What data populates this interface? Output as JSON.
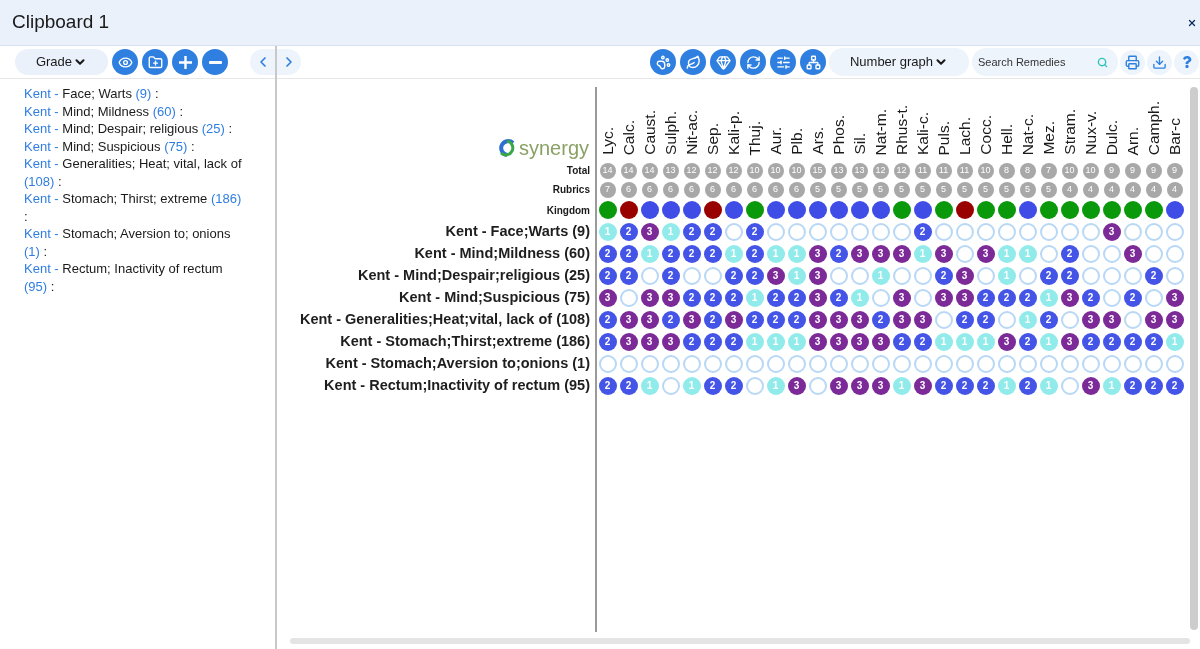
{
  "window": {
    "title": "Clipboard 1"
  },
  "left_toolbar": {
    "grade_dropdown": "Grade"
  },
  "clipboard_list": [
    {
      "source": "Kent -",
      "rubric": "Face; Warts",
      "count": "(9)",
      "suffix": ":"
    },
    {
      "source": "Kent -",
      "rubric": "Mind; Mildness",
      "count": "(60)",
      "suffix": ":"
    },
    {
      "source": "Kent -",
      "rubric": "Mind; Despair; religious",
      "count": "(25)",
      "suffix": ":"
    },
    {
      "source": "Kent -",
      "rubric": "Mind; Suspicious",
      "count": "(75)",
      "suffix": ":"
    },
    {
      "source": "Kent -",
      "rubric": "Generalities; Heat; vital, lack of",
      "count": "(108)",
      "suffix": ":"
    },
    {
      "source": "Kent -",
      "rubric": "Stomach; Thirst; extreme",
      "count": "(186)",
      "suffix": ":"
    },
    {
      "source": "Kent -",
      "rubric": "Stomach; Aversion to; onions",
      "count": "(1)",
      "suffix": ":"
    },
    {
      "source": "Kent -",
      "rubric": "Rectum; Inactivity of rectum",
      "count": "(95)",
      "suffix": ":"
    }
  ],
  "right_toolbar": {
    "graph_dropdown": "Number graph",
    "search": {
      "placeholder": "Search Remedies"
    }
  },
  "chart": {
    "logo": "synergy",
    "row_headers": {
      "total": "Total",
      "rubrics": "Rubrics",
      "kingdom": "Kingdom"
    },
    "remedies": [
      {
        "name": "Lyc.",
        "total": "14",
        "rubrics": "7",
        "color": "#0a990a"
      },
      {
        "name": "Calc.",
        "total": "14",
        "rubrics": "6",
        "color": "#990000"
      },
      {
        "name": "Caust.",
        "total": "14",
        "rubrics": "6",
        "color": "#3f4ce6"
      },
      {
        "name": "Sulph.",
        "total": "13",
        "rubrics": "6",
        "color": "#3f4ce6"
      },
      {
        "name": "Nit-ac.",
        "total": "12",
        "rubrics": "6",
        "color": "#3f4ce6"
      },
      {
        "name": "Sep.",
        "total": "12",
        "rubrics": "6",
        "color": "#990000"
      },
      {
        "name": "Kali-p.",
        "total": "12",
        "rubrics": "6",
        "color": "#3f4ce6"
      },
      {
        "name": "Thuj.",
        "total": "10",
        "rubrics": "6",
        "color": "#0a990a"
      },
      {
        "name": "Aur.",
        "total": "10",
        "rubrics": "6",
        "color": "#3f4ce6"
      },
      {
        "name": "Plb.",
        "total": "10",
        "rubrics": "6",
        "color": "#3f4ce6"
      },
      {
        "name": "Ars.",
        "total": "15",
        "rubrics": "5",
        "color": "#3f4ce6"
      },
      {
        "name": "Phos.",
        "total": "13",
        "rubrics": "5",
        "color": "#3f4ce6"
      },
      {
        "name": "Sil.",
        "total": "13",
        "rubrics": "5",
        "color": "#3f4ce6"
      },
      {
        "name": "Nat-m.",
        "total": "12",
        "rubrics": "5",
        "color": "#3f4ce6"
      },
      {
        "name": "Rhus-t.",
        "total": "12",
        "rubrics": "5",
        "color": "#0a990a"
      },
      {
        "name": "Kali-c.",
        "total": "11",
        "rubrics": "5",
        "color": "#3f4ce6"
      },
      {
        "name": "Puls.",
        "total": "11",
        "rubrics": "5",
        "color": "#0a990a"
      },
      {
        "name": "Lach.",
        "total": "11",
        "rubrics": "5",
        "color": "#990000"
      },
      {
        "name": "Cocc.",
        "total": "10",
        "rubrics": "5",
        "color": "#0a990a"
      },
      {
        "name": "Hell.",
        "total": "8",
        "rubrics": "5",
        "color": "#0a990a"
      },
      {
        "name": "Nat-c.",
        "total": "8",
        "rubrics": "5",
        "color": "#3f4ce6"
      },
      {
        "name": "Mez.",
        "total": "7",
        "rubrics": "5",
        "color": "#0a990a"
      },
      {
        "name": "Stram.",
        "total": "10",
        "rubrics": "4",
        "color": "#0a990a"
      },
      {
        "name": "Nux-v.",
        "total": "10",
        "rubrics": "4",
        "color": "#0a990a"
      },
      {
        "name": "Dulc.",
        "total": "9",
        "rubrics": "4",
        "color": "#0a990a"
      },
      {
        "name": "Arn.",
        "total": "9",
        "rubrics": "4",
        "color": "#0a990a"
      },
      {
        "name": "Camph.",
        "total": "9",
        "rubrics": "4",
        "color": "#0a990a"
      },
      {
        "name": "Bar-c",
        "total": "9",
        "rubrics": "4",
        "color": "#3f4ce6"
      }
    ],
    "rows": [
      {
        "label": "Kent - Face;Warts (9)",
        "cells": [
          {
            "grade": "1",
            "color": "#92ebeb"
          },
          {
            "grade": "2",
            "color": "#4454e6"
          },
          {
            "grade": "3",
            "color": "#7b2a97"
          },
          {
            "grade": "1",
            "color": "#92ebeb"
          },
          {
            "grade": "2",
            "color": "#4454e6"
          },
          {
            "grade": "2",
            "color": "#4454e6"
          },
          null,
          {
            "grade": "2",
            "color": "#4454e6"
          },
          null,
          null,
          null,
          null,
          null,
          null,
          null,
          {
            "grade": "2",
            "color": "#4454e6"
          },
          null,
          null,
          null,
          null,
          null,
          null,
          null,
          null,
          {
            "grade": "3",
            "color": "#7b2a97"
          },
          null,
          null,
          null
        ]
      },
      {
        "label": "Kent - Mind;Mildness (60)",
        "cells": [
          {
            "grade": "2",
            "color": "#4454e6"
          },
          {
            "grade": "2",
            "color": "#4454e6"
          },
          {
            "grade": "1",
            "color": "#92ebeb"
          },
          {
            "grade": "2",
            "color": "#4454e6"
          },
          {
            "grade": "2",
            "color": "#4454e6"
          },
          {
            "grade": "2",
            "color": "#4454e6"
          },
          {
            "grade": "1",
            "color": "#92ebeb"
          },
          {
            "grade": "2",
            "color": "#4454e6"
          },
          {
            "grade": "1",
            "color": "#92ebeb"
          },
          {
            "grade": "1",
            "color": "#92ebeb"
          },
          {
            "grade": "3",
            "color": "#7b2a97"
          },
          {
            "grade": "2",
            "color": "#4454e6"
          },
          {
            "grade": "3",
            "color": "#7b2a97"
          },
          {
            "grade": "3",
            "color": "#7b2a97"
          },
          {
            "grade": "3",
            "color": "#7b2a97"
          },
          {
            "grade": "1",
            "color": "#92ebeb"
          },
          {
            "grade": "3",
            "color": "#7b2a97"
          },
          null,
          {
            "grade": "3",
            "color": "#7b2a97"
          },
          {
            "grade": "1",
            "color": "#92ebeb"
          },
          {
            "grade": "1",
            "color": "#92ebeb"
          },
          null,
          {
            "grade": "2",
            "color": "#4454e6"
          },
          null,
          null,
          {
            "grade": "3",
            "color": "#7b2a97"
          },
          null,
          null
        ]
      },
      {
        "label": "Kent - Mind;Despair;religious (25)",
        "cells": [
          {
            "grade": "2",
            "color": "#4454e6"
          },
          {
            "grade": "2",
            "color": "#4454e6"
          },
          null,
          {
            "grade": "2",
            "color": "#4454e6"
          },
          null,
          null,
          {
            "grade": "2",
            "color": "#4454e6"
          },
          {
            "grade": "2",
            "color": "#4454e6"
          },
          {
            "grade": "3",
            "color": "#7b2a97"
          },
          {
            "grade": "1",
            "color": "#92ebeb"
          },
          {
            "grade": "3",
            "color": "#7b2a97"
          },
          null,
          null,
          {
            "grade": "1",
            "color": "#92ebeb"
          },
          null,
          null,
          {
            "grade": "2",
            "color": "#4454e6"
          },
          {
            "grade": "3",
            "color": "#7b2a97"
          },
          null,
          {
            "grade": "1",
            "color": "#92ebeb"
          },
          null,
          {
            "grade": "2",
            "color": "#4454e6"
          },
          {
            "grade": "2",
            "color": "#4454e6"
          },
          null,
          null,
          null,
          {
            "grade": "2",
            "color": "#4454e6"
          },
          null
        ]
      },
      {
        "label": "Kent - Mind;Suspicious (75)",
        "cells": [
          {
            "grade": "3",
            "color": "#7b2a97"
          },
          null,
          {
            "grade": "3",
            "color": "#7b2a97"
          },
          {
            "grade": "3",
            "color": "#7b2a97"
          },
          {
            "grade": "2",
            "color": "#4454e6"
          },
          {
            "grade": "2",
            "color": "#4454e6"
          },
          {
            "grade": "2",
            "color": "#4454e6"
          },
          {
            "grade": "1",
            "color": "#92ebeb"
          },
          {
            "grade": "2",
            "color": "#4454e6"
          },
          {
            "grade": "2",
            "color": "#4454e6"
          },
          {
            "grade": "3",
            "color": "#7b2a97"
          },
          {
            "grade": "2",
            "color": "#4454e6"
          },
          {
            "grade": "1",
            "color": "#92ebeb"
          },
          null,
          {
            "grade": "3",
            "color": "#7b2a97"
          },
          null,
          {
            "grade": "3",
            "color": "#7b2a97"
          },
          {
            "grade": "3",
            "color": "#7b2a97"
          },
          {
            "grade": "2",
            "color": "#4454e6"
          },
          {
            "grade": "2",
            "color": "#4454e6"
          },
          {
            "grade": "2",
            "color": "#4454e6"
          },
          {
            "grade": "1",
            "color": "#92ebeb"
          },
          {
            "grade": "3",
            "color": "#7b2a97"
          },
          {
            "grade": "2",
            "color": "#4454e6"
          },
          null,
          {
            "grade": "2",
            "color": "#4454e6"
          },
          null,
          {
            "grade": "3",
            "color": "#7b2a97"
          }
        ]
      },
      {
        "label": "Kent - Generalities;Heat;vital, lack of (108)",
        "cells": [
          {
            "grade": "2",
            "color": "#4454e6"
          },
          {
            "grade": "3",
            "color": "#7b2a97"
          },
          {
            "grade": "3",
            "color": "#7b2a97"
          },
          {
            "grade": "2",
            "color": "#4454e6"
          },
          {
            "grade": "3",
            "color": "#7b2a97"
          },
          {
            "grade": "2",
            "color": "#4454e6"
          },
          {
            "grade": "3",
            "color": "#7b2a97"
          },
          {
            "grade": "2",
            "color": "#4454e6"
          },
          {
            "grade": "2",
            "color": "#4454e6"
          },
          {
            "grade": "2",
            "color": "#4454e6"
          },
          {
            "grade": "3",
            "color": "#7b2a97"
          },
          {
            "grade": "3",
            "color": "#7b2a97"
          },
          {
            "grade": "3",
            "color": "#7b2a97"
          },
          {
            "grade": "2",
            "color": "#4454e6"
          },
          {
            "grade": "3",
            "color": "#7b2a97"
          },
          {
            "grade": "3",
            "color": "#7b2a97"
          },
          null,
          {
            "grade": "2",
            "color": "#4454e6"
          },
          {
            "grade": "2",
            "color": "#4454e6"
          },
          null,
          {
            "grade": "1",
            "color": "#92ebeb"
          },
          {
            "grade": "2",
            "color": "#4454e6"
          },
          null,
          {
            "grade": "3",
            "color": "#7b2a97"
          },
          {
            "grade": "3",
            "color": "#7b2a97"
          },
          null,
          {
            "grade": "3",
            "color": "#7b2a97"
          },
          {
            "grade": "3",
            "color": "#7b2a97"
          }
        ]
      },
      {
        "label": "Kent - Stomach;Thirst;extreme (186)",
        "cells": [
          {
            "grade": "2",
            "color": "#4454e6"
          },
          {
            "grade": "3",
            "color": "#7b2a97"
          },
          {
            "grade": "3",
            "color": "#7b2a97"
          },
          {
            "grade": "3",
            "color": "#7b2a97"
          },
          {
            "grade": "2",
            "color": "#4454e6"
          },
          {
            "grade": "2",
            "color": "#4454e6"
          },
          {
            "grade": "2",
            "color": "#4454e6"
          },
          {
            "grade": "1",
            "color": "#92ebeb"
          },
          {
            "grade": "1",
            "color": "#92ebeb"
          },
          {
            "grade": "1",
            "color": "#92ebeb"
          },
          {
            "grade": "3",
            "color": "#7b2a97"
          },
          {
            "grade": "3",
            "color": "#7b2a97"
          },
          {
            "grade": "3",
            "color": "#7b2a97"
          },
          {
            "grade": "3",
            "color": "#7b2a97"
          },
          {
            "grade": "2",
            "color": "#4454e6"
          },
          {
            "grade": "2",
            "color": "#4454e6"
          },
          {
            "grade": "1",
            "color": "#92ebeb"
          },
          {
            "grade": "1",
            "color": "#92ebeb"
          },
          {
            "grade": "1",
            "color": "#92ebeb"
          },
          {
            "grade": "3",
            "color": "#7b2a97"
          },
          {
            "grade": "2",
            "color": "#4454e6"
          },
          {
            "grade": "1",
            "color": "#92ebeb"
          },
          {
            "grade": "3",
            "color": "#7b2a97"
          },
          {
            "grade": "2",
            "color": "#4454e6"
          },
          {
            "grade": "2",
            "color": "#4454e6"
          },
          {
            "grade": "2",
            "color": "#4454e6"
          },
          {
            "grade": "2",
            "color": "#4454e6"
          },
          {
            "grade": "1",
            "color": "#92ebeb"
          }
        ]
      },
      {
        "label": "Kent - Stomach;Aversion to;onions (1)",
        "cells": [
          null,
          null,
          null,
          null,
          null,
          null,
          null,
          null,
          null,
          null,
          null,
          null,
          null,
          null,
          null,
          null,
          null,
          null,
          null,
          null,
          null,
          null,
          null,
          null,
          null,
          null,
          null,
          null
        ]
      },
      {
        "label": "Kent - Rectum;Inactivity of rectum (95)",
        "cells": [
          {
            "grade": "2",
            "color": "#4454e6"
          },
          {
            "grade": "2",
            "color": "#4454e6"
          },
          {
            "grade": "1",
            "color": "#92ebeb"
          },
          null,
          {
            "grade": "1",
            "color": "#92ebeb"
          },
          {
            "grade": "2",
            "color": "#4454e6"
          },
          {
            "grade": "2",
            "color": "#4454e6"
          },
          null,
          {
            "grade": "1",
            "color": "#92ebeb"
          },
          {
            "grade": "3",
            "color": "#7b2a97"
          },
          null,
          {
            "grade": "3",
            "color": "#7b2a97"
          },
          {
            "grade": "3",
            "color": "#7b2a97"
          },
          {
            "grade": "3",
            "color": "#7b2a97"
          },
          {
            "grade": "1",
            "color": "#92ebeb"
          },
          {
            "grade": "3",
            "color": "#7b2a97"
          },
          {
            "grade": "2",
            "color": "#4454e6"
          },
          {
            "grade": "2",
            "color": "#4454e6"
          },
          {
            "grade": "2",
            "color": "#4454e6"
          },
          {
            "grade": "1",
            "color": "#92ebeb"
          },
          {
            "grade": "2",
            "color": "#4454e6"
          },
          {
            "grade": "1",
            "color": "#92ebeb"
          },
          null,
          {
            "grade": "3",
            "color": "#7b2a97"
          },
          {
            "grade": "1",
            "color": "#92ebeb"
          },
          {
            "grade": "2",
            "color": "#4454e6"
          },
          {
            "grade": "2",
            "color": "#4454e6"
          },
          {
            "grade": "2",
            "color": "#4454e6"
          }
        ]
      }
    ]
  }
}
